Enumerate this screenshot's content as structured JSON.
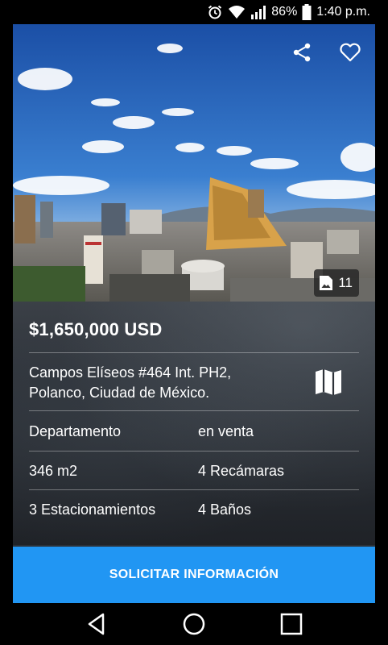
{
  "status_bar": {
    "battery": "86%",
    "time": "1:40 p.m.",
    "icons": [
      "alarm-icon",
      "wifi-icon",
      "signal-icon",
      "battery-icon"
    ]
  },
  "hero": {
    "actions": [
      "share-icon",
      "favorite-heart-icon"
    ],
    "photo_count": "11"
  },
  "listing": {
    "price": "$1,650,000 USD",
    "address_line1": "Campos Elíseos #464 Int. PH2,",
    "address_line2": "Polanco, Ciudad de México.",
    "map_icon": "map-icon",
    "rows": [
      {
        "left": "Departamento",
        "right": "en venta"
      },
      {
        "left": "346 m2",
        "right": "4 Recámaras"
      },
      {
        "left": "3 Estacionamientos",
        "right": "4 Baños"
      }
    ]
  },
  "cta": {
    "label": "SOLICITAR INFORMACIÓN"
  },
  "colors": {
    "accent": "#2196f3",
    "panel": "#2c3138"
  },
  "nav_bar": {
    "buttons": [
      "back-icon",
      "home-icon",
      "recents-icon"
    ]
  }
}
